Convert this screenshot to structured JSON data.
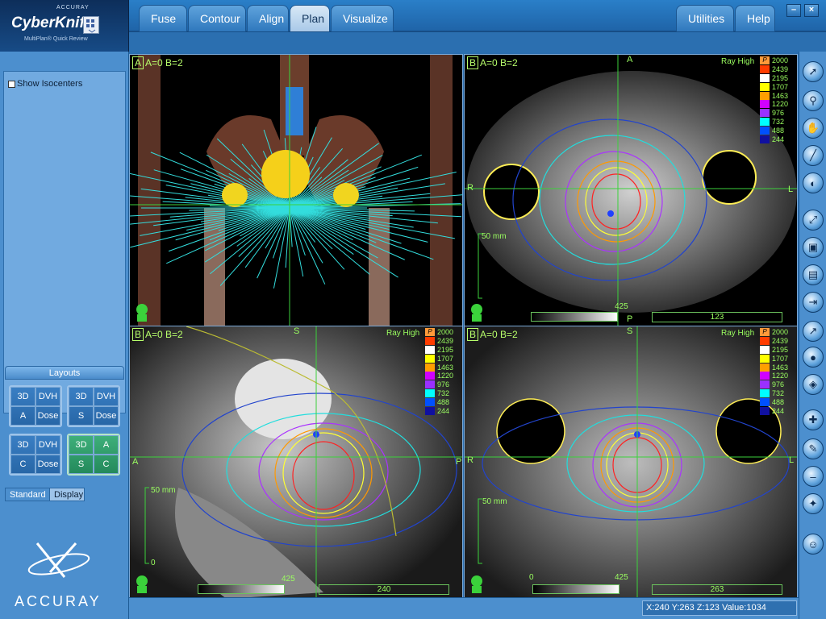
{
  "brand": {
    "company": "ACCURAY",
    "product": "CyberKnife",
    "subtitle": "MultiPlan® Quick Review",
    "footer": "ACCURAY"
  },
  "tabs": [
    {
      "label": "Fuse",
      "active": false
    },
    {
      "label": "Contour",
      "active": false
    },
    {
      "label": "Align",
      "active": false
    },
    {
      "label": "Plan",
      "active": true
    },
    {
      "label": "Visualize",
      "active": false
    }
  ],
  "right_tabs": [
    {
      "label": "Utilities"
    },
    {
      "label": "Help"
    }
  ],
  "window_controls": {
    "minimize": "–",
    "close": "×"
  },
  "sidebar": {
    "show_isocenters": {
      "label": "Show Isocenters",
      "checked": false
    },
    "layouts_title": "Layouts",
    "layouts": [
      {
        "cells": [
          "3D",
          "DVH",
          "A",
          "Dose"
        ],
        "selected": false
      },
      {
        "cells": [
          "3D",
          "DVH",
          "S",
          "Dose"
        ],
        "selected": false
      },
      {
        "cells": [
          "3D",
          "DVH",
          "C",
          "Dose"
        ],
        "selected": false
      },
      {
        "cells": [
          "3D",
          "A",
          "S",
          "C"
        ],
        "selected": true
      }
    ],
    "bottom_tabs": [
      {
        "label": "Standard",
        "active": true
      },
      {
        "label": "Display",
        "active": false
      }
    ]
  },
  "legend_header": "P",
  "legend_values": [
    "2000",
    "2439",
    "2195",
    "1707",
    "1463",
    "1220",
    "976",
    "732",
    "488",
    "244"
  ],
  "legend_colors": [
    "#ff2a00",
    "#ff3c00",
    "#ffffff",
    "#ffff00",
    "#ff9f00",
    "#d000ff",
    "#9a30ff",
    "#00ffff",
    "#0050ff",
    "#1010a0"
  ],
  "viewports": {
    "v3d": {
      "tag": "A",
      "label": "A=0 B=2"
    },
    "axial": {
      "tag": "B",
      "label": "A=0 B=2",
      "top": "A",
      "bottom": "P",
      "left": "R",
      "right": "L",
      "ray": "Ray High",
      "slice": "123",
      "gray_max": "425",
      "scale": "50 mm"
    },
    "sagittal": {
      "tag": "B",
      "label": "A=0 B=2",
      "top": "S",
      "left": "A",
      "right": "P",
      "ray": "Ray High",
      "slice": "240",
      "gray_max": "425",
      "scale": "50 mm",
      "scale_zero": "0"
    },
    "coronal": {
      "tag": "B",
      "label": "A=0 B=2",
      "top": "S",
      "left": "R",
      "right": "L",
      "ray": "Ray High",
      "slice": "263",
      "gray_min": "0",
      "gray_max": "425",
      "scale": "50 mm"
    }
  },
  "status": {
    "coords": "X:240 Y:263 Z:123  Value:1034"
  },
  "tools": [
    "pointer-icon",
    "zoom-icon",
    "pan-icon",
    "ruler-icon",
    "window-level-icon",
    "fit-icon",
    "cube-icon",
    "erase-icon",
    "export-icon",
    "beam-icon",
    "sphere-icon",
    "mesh-icon",
    "node-add-icon",
    "node-edit-icon",
    "node-remove-icon",
    "node-star-icon",
    "person-icon"
  ]
}
